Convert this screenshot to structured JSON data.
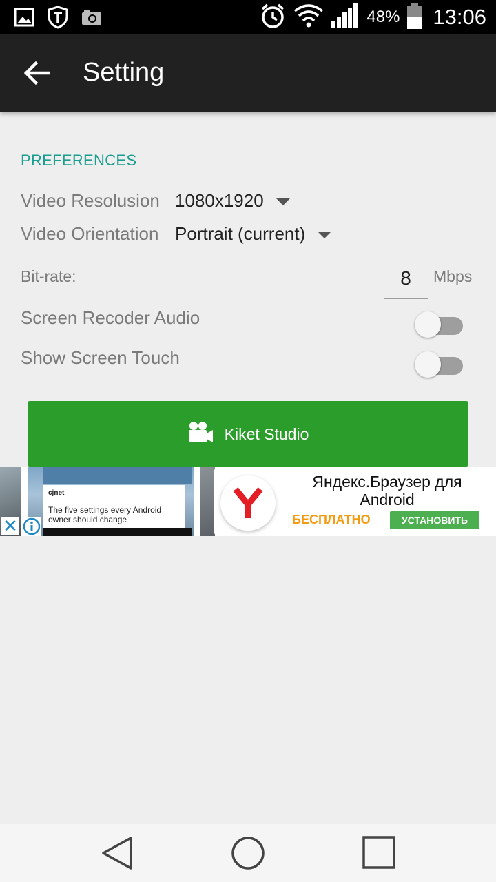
{
  "status_bar": {
    "left_icons": [
      "image-icon",
      "shield-t-icon",
      "camera-icon"
    ],
    "right_icons": [
      "alarm-icon",
      "wifi-icon",
      "signal-icon",
      "battery-icon"
    ],
    "battery_percent": "48%",
    "time": "13:06"
  },
  "app_bar": {
    "back_icon": "arrow-left-icon",
    "title": "Setting"
  },
  "preferences": {
    "header": "PREFERENCES",
    "video_resolution": {
      "label": "Video Resolusion",
      "value": "1080x1920"
    },
    "video_orientation": {
      "label": "Video Orientation",
      "value": "Portrait (current)"
    },
    "bitrate": {
      "label": "Bit-rate:",
      "value": "8",
      "unit": "Mbps"
    },
    "screen_recorder_audio": {
      "label": "Screen Recoder Audio",
      "on": false
    },
    "show_screen_touch": {
      "label": "Show Screen Touch",
      "on": false
    }
  },
  "primary_button": {
    "icon": "video-camera-icon",
    "label": "Kiket Studio"
  },
  "ad": {
    "card_brand": "cjnet",
    "card_text": "The five settings every Android owner should change",
    "title": "Яндекс.Браузер для Android",
    "price": "БЕСПЛАТНО",
    "install": "УСТАНОВИТЬ"
  },
  "nav_bar": {
    "buttons": [
      "back-triangle-icon",
      "home-circle-icon",
      "recents-square-icon"
    ]
  },
  "colors": {
    "accent": "#1a9e8f",
    "button_green": "#2a9d2a",
    "app_bar": "#212121",
    "background": "#eeeeee"
  }
}
